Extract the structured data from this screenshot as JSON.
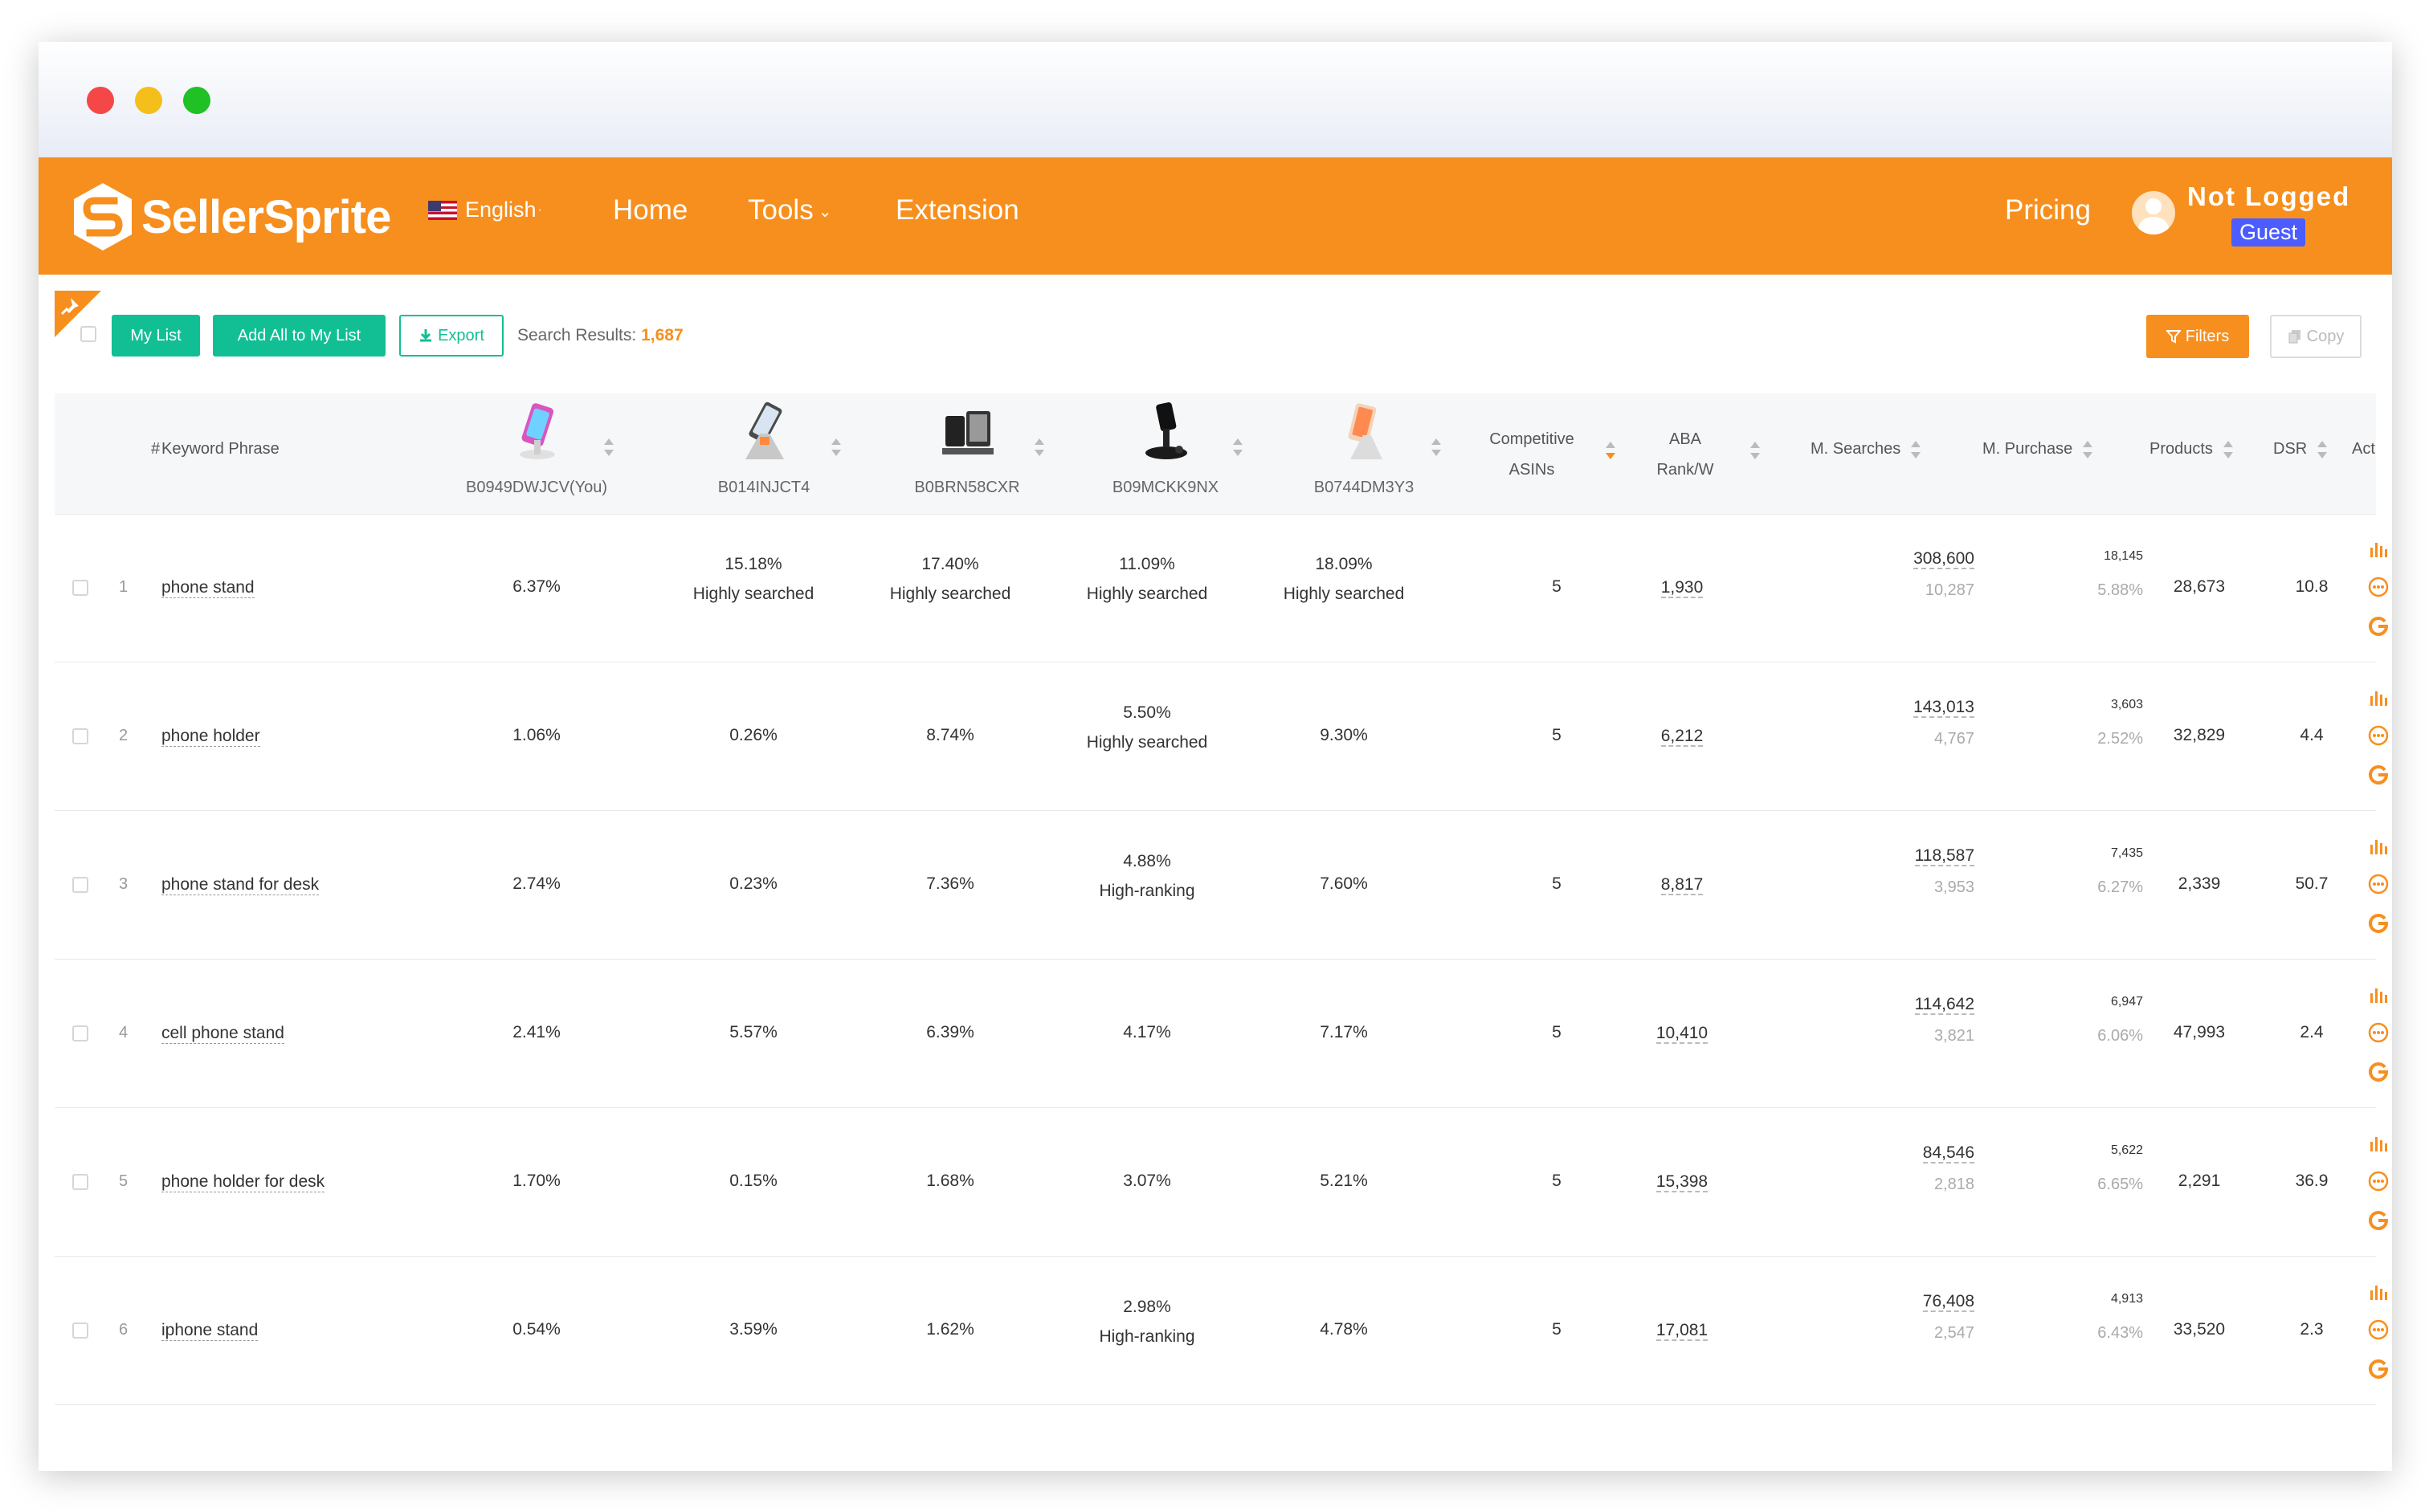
{
  "nav": {
    "brand": "SellerSprite",
    "language": "English",
    "home": "Home",
    "tools": "Tools",
    "extension": "Extension",
    "pricing": "Pricing",
    "user_name": "Not Logged",
    "user_role": "Guest"
  },
  "toolbar": {
    "my_list": "My List",
    "add_all": "Add All to My List",
    "export": "Export",
    "search_results_label": "Search Results:",
    "search_results_count": "1,687",
    "filters": "Filters",
    "copy": "Copy"
  },
  "table": {
    "headers": {
      "num": "#",
      "keyword": "Keyword Phrase",
      "products": [
        "B0949DWJCV(You)",
        "B014INJCT4",
        "B0BRN58CXR",
        "B09MCKK9NX",
        "B0744DM3Y3"
      ],
      "competitive_1": "Competitive",
      "competitive_2": "ASINs",
      "aba_1": "ABA",
      "aba_2": "Rank/W",
      "searches": "M. Searches",
      "purchase": "M. Purchase",
      "products_count": "Products",
      "dsr": "DSR",
      "act": "Act"
    },
    "rows": [
      {
        "num": "1",
        "keyword": "phone stand",
        "p": [
          {
            "pct": "6.37%",
            "tag": ""
          },
          {
            "pct": "15.18%",
            "tag": "Highly searched"
          },
          {
            "pct": "17.40%",
            "tag": "Highly searched"
          },
          {
            "pct": "11.09%",
            "tag": "Highly searched"
          },
          {
            "pct": "18.09%",
            "tag": "Highly searched"
          }
        ],
        "competitive": "5",
        "aba": "1,930",
        "searches": "308,600",
        "searches_sub": "10,287",
        "purchase": "18,145",
        "purchase_sub": "5.88%",
        "products": "28,673",
        "dsr": "10.8"
      },
      {
        "num": "2",
        "keyword": "phone holder",
        "p": [
          {
            "pct": "1.06%",
            "tag": ""
          },
          {
            "pct": "0.26%",
            "tag": ""
          },
          {
            "pct": "8.74%",
            "tag": ""
          },
          {
            "pct": "5.50%",
            "tag": "Highly searched"
          },
          {
            "pct": "9.30%",
            "tag": ""
          }
        ],
        "competitive": "5",
        "aba": "6,212",
        "searches": "143,013",
        "searches_sub": "4,767",
        "purchase": "3,603",
        "purchase_sub": "2.52%",
        "products": "32,829",
        "dsr": "4.4"
      },
      {
        "num": "3",
        "keyword": "phone stand for desk",
        "p": [
          {
            "pct": "2.74%",
            "tag": ""
          },
          {
            "pct": "0.23%",
            "tag": ""
          },
          {
            "pct": "7.36%",
            "tag": ""
          },
          {
            "pct": "4.88%",
            "tag": "High-ranking"
          },
          {
            "pct": "7.60%",
            "tag": ""
          }
        ],
        "competitive": "5",
        "aba": "8,817",
        "searches": "118,587",
        "searches_sub": "3,953",
        "purchase": "7,435",
        "purchase_sub": "6.27%",
        "products": "2,339",
        "dsr": "50.7"
      },
      {
        "num": "4",
        "keyword": "cell phone stand",
        "p": [
          {
            "pct": "2.41%",
            "tag": ""
          },
          {
            "pct": "5.57%",
            "tag": ""
          },
          {
            "pct": "6.39%",
            "tag": ""
          },
          {
            "pct": "4.17%",
            "tag": ""
          },
          {
            "pct": "7.17%",
            "tag": ""
          }
        ],
        "competitive": "5",
        "aba": "10,410",
        "searches": "114,642",
        "searches_sub": "3,821",
        "purchase": "6,947",
        "purchase_sub": "6.06%",
        "products": "47,993",
        "dsr": "2.4"
      },
      {
        "num": "5",
        "keyword": "phone holder for desk",
        "p": [
          {
            "pct": "1.70%",
            "tag": ""
          },
          {
            "pct": "0.15%",
            "tag": ""
          },
          {
            "pct": "1.68%",
            "tag": ""
          },
          {
            "pct": "3.07%",
            "tag": ""
          },
          {
            "pct": "5.21%",
            "tag": ""
          }
        ],
        "competitive": "5",
        "aba": "15,398",
        "searches": "84,546",
        "searches_sub": "2,818",
        "purchase": "5,622",
        "purchase_sub": "6.65%",
        "products": "2,291",
        "dsr": "36.9"
      },
      {
        "num": "6",
        "keyword": "iphone stand",
        "p": [
          {
            "pct": "0.54%",
            "tag": ""
          },
          {
            "pct": "3.59%",
            "tag": ""
          },
          {
            "pct": "1.62%",
            "tag": ""
          },
          {
            "pct": "2.98%",
            "tag": "High-ranking"
          },
          {
            "pct": "4.78%",
            "tag": ""
          }
        ],
        "competitive": "5",
        "aba": "17,081",
        "searches": "76,408",
        "searches_sub": "2,547",
        "purchase": "4,913",
        "purchase_sub": "6.43%",
        "products": "33,520",
        "dsr": "2.3"
      }
    ]
  },
  "icons": {
    "chart": "bar-chart-icon",
    "more": "more-icon",
    "google": "google-icon",
    "pin": "pin-icon",
    "download": "download-icon",
    "filter": "filter-icon",
    "copy": "copy-icon"
  },
  "colors": {
    "brand_orange": "#f78f1e",
    "action_green": "#12bf95",
    "guest_badge": "#4b5dff"
  }
}
